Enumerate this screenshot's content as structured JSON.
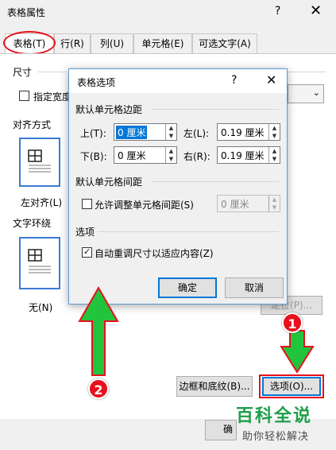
{
  "outer": {
    "title": "表格属性",
    "help": "?",
    "close": "✕",
    "tabs": [
      "表格(T)",
      "行(R)",
      "列(U)",
      "单元格(E)",
      "可选文字(A)"
    ],
    "size_label": "尺寸",
    "preferred_width": "指定宽度",
    "alignment_label": "对齐方式",
    "align_left": "左对齐(L)",
    "text_wrap_label": "文字环绕",
    "wrap_none": "无(N)",
    "positioning": "定位(P)...",
    "borders_shading": "边框和底纹(B)...",
    "options": "选项(O)...",
    "ok_partial": "确"
  },
  "inner": {
    "title": "表格选项",
    "help": "?",
    "close": "✕",
    "margins_label": "默认单元格边距",
    "top_label": "上(T):",
    "top_value": "0 厘米",
    "left_label": "左(L):",
    "left_value": "0.19 厘米",
    "bottom_label": "下(B):",
    "bottom_value": "0 厘米",
    "right_label": "右(R):",
    "right_value": "0.19 厘米",
    "spacing_label": "默认单元格间距",
    "allow_spacing": "允许调整单元格间距(S)",
    "spacing_value": "0 厘米",
    "options_label": "选项",
    "auto_resize": "自动重调尺寸以适应内容(Z)",
    "auto_resize_checked": true,
    "ok": "确定",
    "cancel": "取消"
  },
  "annotations": {
    "step1": "1",
    "step2": "2"
  },
  "watermark": {
    "brand": "百科全说",
    "tagline": "助你轻松解决"
  }
}
